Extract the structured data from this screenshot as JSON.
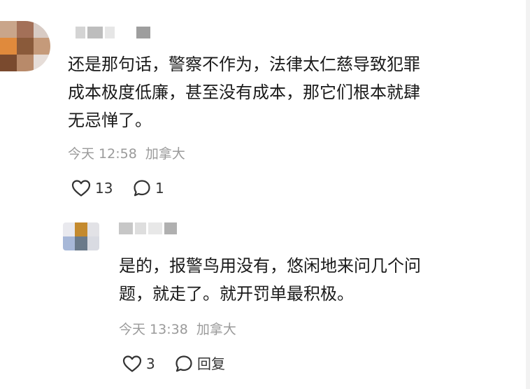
{
  "comments": [
    {
      "text_lines": [
        "还是那句话，警察不作为，法律太仁慈导致犯罪",
        "成本极度低廉，甚至没有成本，那它们根本就肆",
        "无忌惮了。"
      ],
      "time": "今天 12:58",
      "location": "加拿大",
      "likes": "13",
      "reply_count": "1"
    }
  ],
  "reply": {
    "text_lines": [
      "是的，报警鸟用没有，悠闲地来问几个问",
      "题，就走了。就开罚单最积极。"
    ],
    "time": "今天 13:38",
    "location": "加拿大",
    "likes": "3",
    "reply_label": "回复"
  },
  "colors": {
    "text": "#1a1a1a",
    "meta": "#9a9a9a",
    "icon": "#333333"
  },
  "icons": {
    "like": "heart-outline-icon",
    "comment": "speech-bubble-icon"
  }
}
